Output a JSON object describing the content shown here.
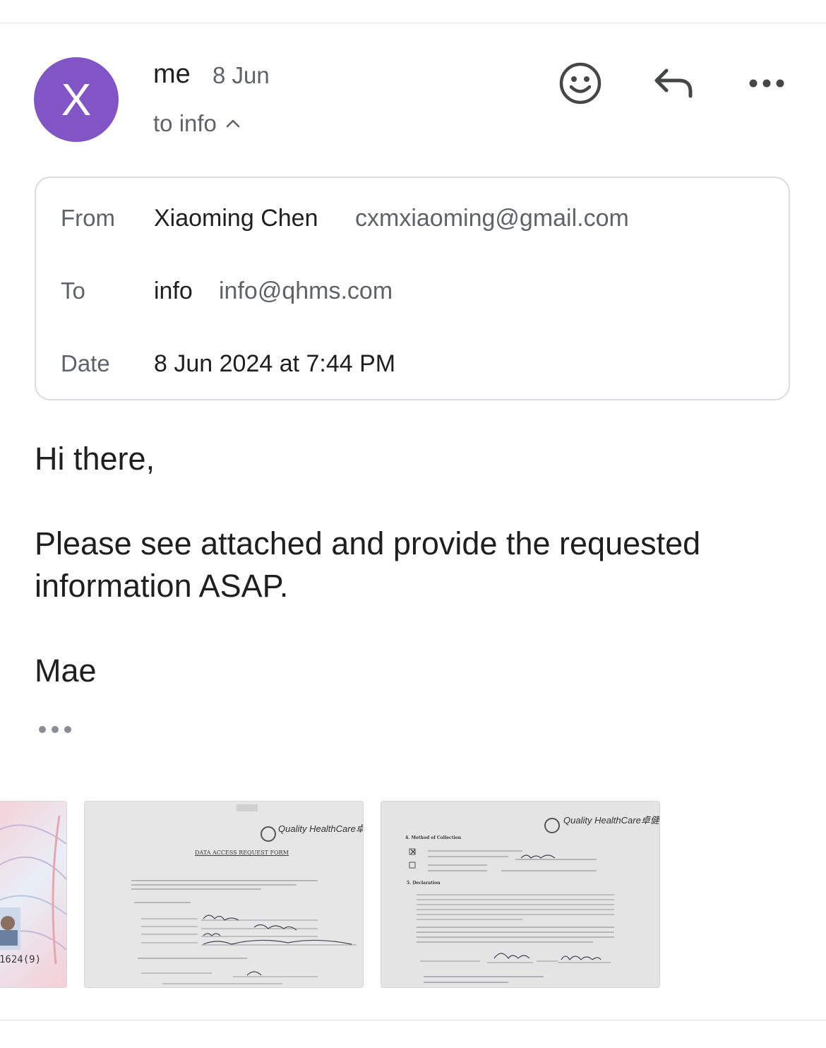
{
  "message": {
    "avatar_initial": "X",
    "sender_short": "me",
    "date_short": "8 Jun",
    "recipient_toggle": "to info"
  },
  "details": {
    "from_label": "From",
    "from_name": "Xiaoming Chen",
    "from_email": "cxmxiaoming@gmail.com",
    "to_label": "To",
    "to_name": "info",
    "to_email": "info@qhms.com",
    "date_label": "Date",
    "date_value": "8 Jun 2024 at 7:44 PM"
  },
  "body": {
    "greeting": "Hi there,",
    "line1": "Please see attached and provide the requested",
    "line2": "information ASAP.",
    "signature": "Mae"
  },
  "attachments": [
    {
      "id_number_fragment": "1624(9)"
    },
    {
      "brand": "Quality HealthCare",
      "brand_cn": "卓健",
      "form_title": "DATA ACCESS REQUEST FORM"
    },
    {
      "brand": "Quality HealthCare",
      "brand_cn": "卓健",
      "section_4": "4. Method of Collection",
      "section_5": "5. Declaration"
    }
  ],
  "icons": {
    "avatar": "avatar",
    "chevron": "chevron-up-icon",
    "emoji": "emoji-react-icon",
    "reply": "reply-icon",
    "more": "more-options-icon",
    "show_trimmed": "show-trimmed-content-icon"
  },
  "colors": {
    "avatar_bg": "#8155c6",
    "text_primary": "#1f1f1f",
    "text_secondary": "#5f6368",
    "border": "#dadce0"
  }
}
